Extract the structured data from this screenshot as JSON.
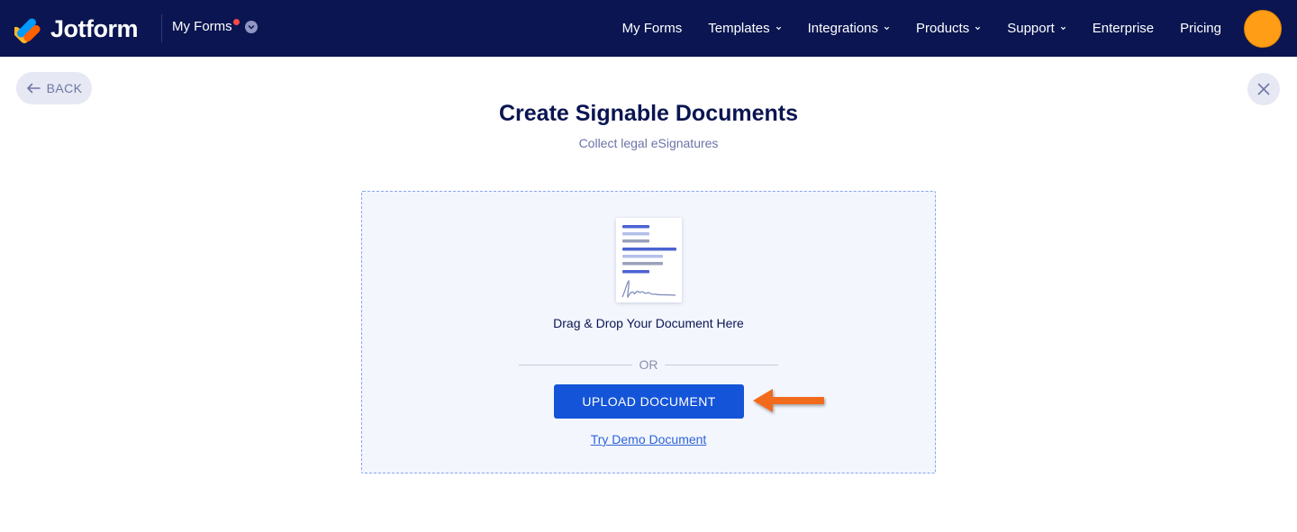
{
  "header": {
    "brand": "Jotform",
    "switcher_label": "My Forms",
    "nav": [
      {
        "label": "My Forms",
        "has_caret": false
      },
      {
        "label": "Templates",
        "has_caret": true
      },
      {
        "label": "Integrations",
        "has_caret": true
      },
      {
        "label": "Products",
        "has_caret": true
      },
      {
        "label": "Support",
        "has_caret": true
      },
      {
        "label": "Enterprise",
        "has_caret": false
      },
      {
        "label": "Pricing",
        "has_caret": false
      }
    ],
    "avatar_color": "#ff9e16",
    "background_color": "#0a1551"
  },
  "page": {
    "back_label": "BACK",
    "title": "Create Signable Documents",
    "subtitle": "Collect legal eSignatures"
  },
  "dropzone": {
    "drag_text": "Drag & Drop Your Document Here",
    "or_text": "OR",
    "upload_label": "UPLOAD DOCUMENT",
    "demo_link": "Try Demo Document",
    "upload_color": "#1454d8"
  },
  "annotation": {
    "arrow_color": "#f26b1d",
    "icon": "arrow-left-icon"
  }
}
